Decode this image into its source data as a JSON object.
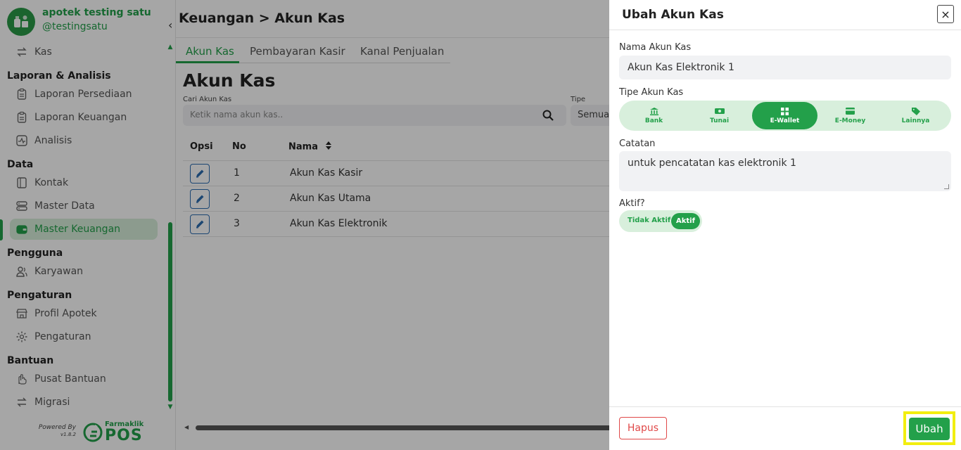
{
  "brand": {
    "name": "apotek testing satu",
    "username": "@testingsatu"
  },
  "sidebar": {
    "top_item": "Kas",
    "sections": [
      {
        "title": "Laporan & Analisis",
        "items": [
          "Laporan Persediaan",
          "Laporan Keuangan",
          "Analisis"
        ]
      },
      {
        "title": "Data",
        "items": [
          "Kontak",
          "Master Data",
          "Master Keuangan"
        ]
      },
      {
        "title": "Pengguna",
        "items": [
          "Karyawan"
        ]
      },
      {
        "title": "Pengaturan",
        "items": [
          "Profil Apotek",
          "Pengaturan"
        ]
      },
      {
        "title": "Bantuan",
        "items": [
          "Pusat Bantuan",
          "Migrasi"
        ]
      }
    ],
    "active_item": "Master Keuangan",
    "powered_by": "Powered By",
    "version": "v1.8.2",
    "product_small": "Farmaklik",
    "product_big": "POS"
  },
  "header": {
    "breadcrumb": "Keuangan > Akun Kas"
  },
  "tabs": [
    "Akun Kas",
    "Pembayaran Kasir",
    "Kanal Penjualan"
  ],
  "page": {
    "title": "Akun Kas",
    "search_label": "Cari Akun Kas",
    "search_placeholder": "Ketik nama akun kas..",
    "type_label": "Tipe",
    "type_value": "Semua"
  },
  "table": {
    "headers": [
      "Opsi",
      "No",
      "Nama"
    ],
    "rows": [
      {
        "no": "1",
        "name": "Akun Kas Kasir"
      },
      {
        "no": "2",
        "name": "Akun Kas Utama"
      },
      {
        "no": "3",
        "name": "Akun Kas Elektronik"
      }
    ]
  },
  "drawer": {
    "title": "Ubah Akun Kas",
    "close": "×",
    "name_label": "Nama Akun Kas",
    "name_value": "Akun Kas Elektronik 1",
    "type_label": "Tipe Akun Kas",
    "type_options": [
      "Bank",
      "Tunai",
      "E-Wallet",
      "E-Money",
      "Lainnya"
    ],
    "type_selected": "E-Wallet",
    "notes_label": "Catatan",
    "notes_value": "untuk pencatatan kas elektronik 1",
    "active_label": "Aktif?",
    "toggle_off": "Tidak Aktif",
    "toggle_on": "Aktif",
    "delete_button": "Hapus",
    "submit_button": "Ubah"
  },
  "colors": {
    "accent": "#23a04a",
    "danger": "#e04848",
    "highlight": "#f2ee0f"
  }
}
